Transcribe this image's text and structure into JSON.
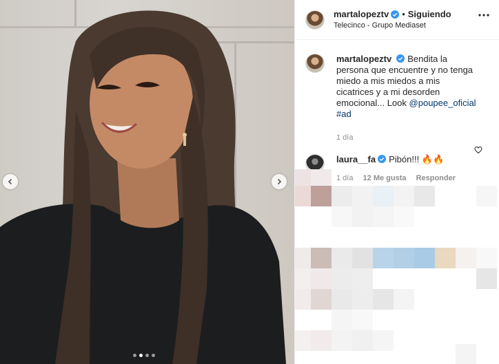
{
  "post": {
    "username": "martalopeztv",
    "follow_label": "Siguiendo",
    "separator": "•",
    "location": "Telecinco - Grupo Mediaset",
    "more_icon": "more-horizontal-icon"
  },
  "caption": {
    "username": "martalopeztv",
    "text": "Bendita la persona que encuentre y no tenga miedo a mis miedos a mis cicatrices y a mi desorden emocional... Look",
    "mention": "@poupee_oficial",
    "hashtag": "#ad",
    "time": "1 día"
  },
  "comments": [
    {
      "username": "laura__fa",
      "text": "Pibón!!!",
      "emoji": "🔥🔥",
      "time": "1 día",
      "likes": "12 Me gusta",
      "reply_label": "Responder"
    }
  ],
  "media": {
    "carousel_count": 4,
    "carousel_active": 2
  },
  "colors": {
    "verified": "#3897f0",
    "link": "#00376b",
    "muted": "#8e8e8e"
  }
}
